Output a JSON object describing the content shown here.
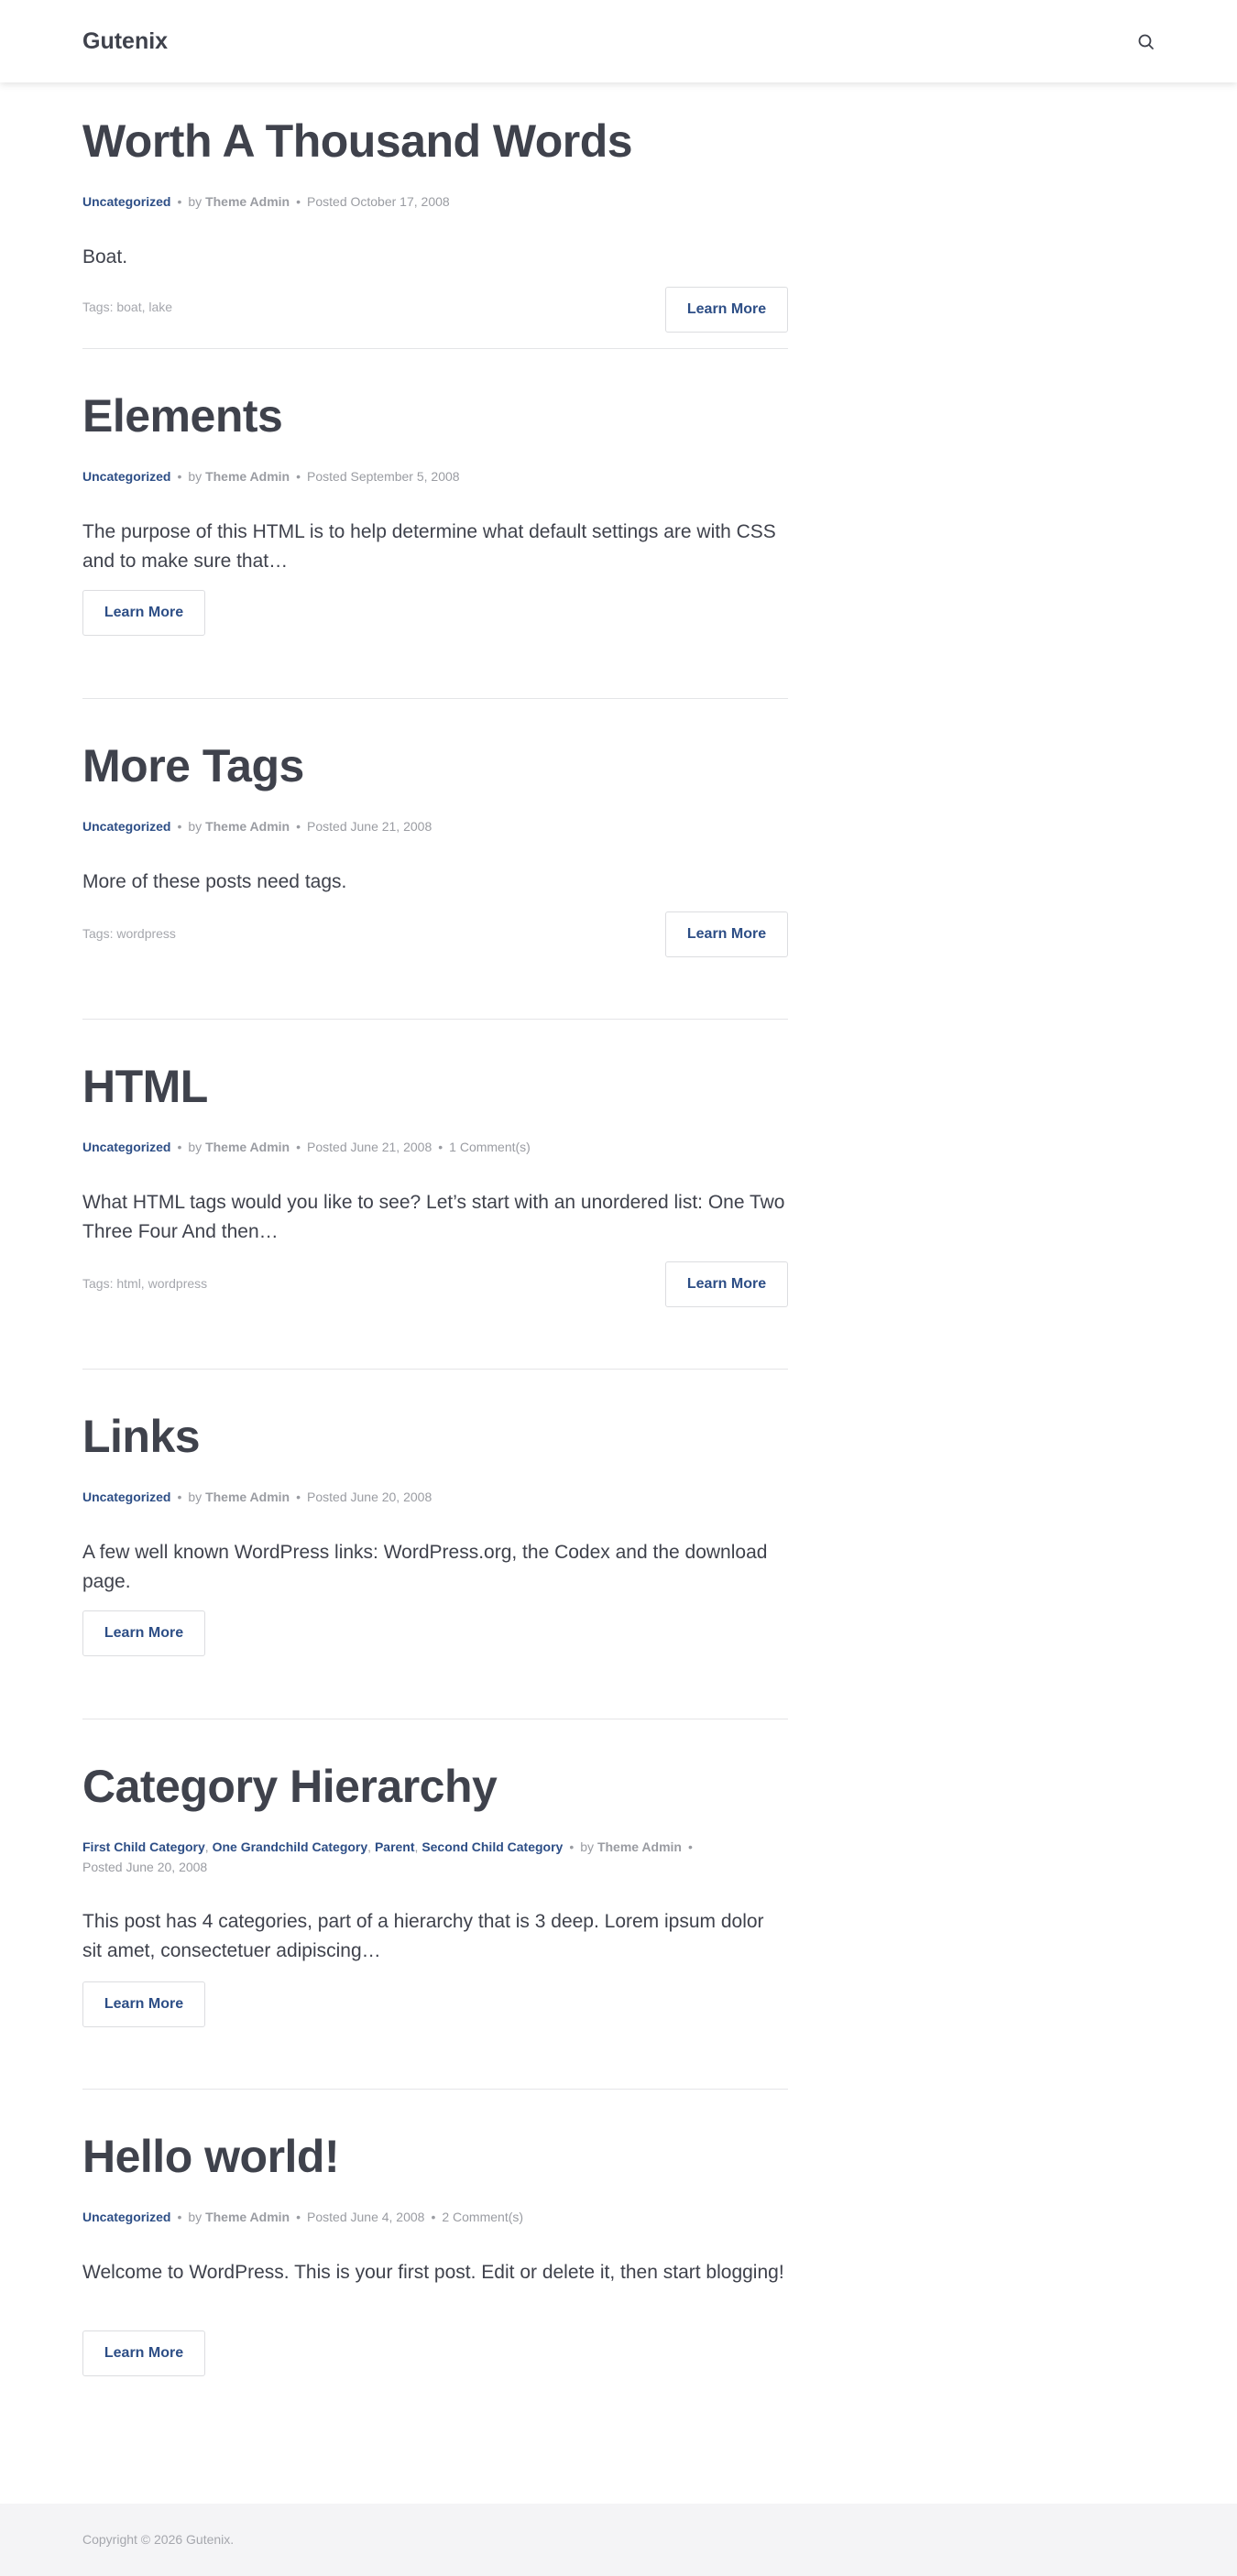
{
  "site": {
    "title": "Gutenix",
    "search_icon": "search-icon"
  },
  "button_label": "Learn More",
  "posts": [
    {
      "title": "Worth A Thousand Words",
      "category": "Uncategorized",
      "author_prefix": "by",
      "author": "Theme Admin",
      "date": "Posted October 17, 2008",
      "excerpt": "Boat.",
      "tags": "Tags: boat, lake"
    },
    {
      "title": "Elements",
      "category": "Uncategorized",
      "author_prefix": "by",
      "author": "Theme Admin",
      "date": "Posted September 5, 2008",
      "excerpt": "The purpose of this HTML is to help determine what default settings are with CSS and to make sure that…"
    },
    {
      "title": "More Tags",
      "category": "Uncategorized",
      "author_prefix": "by",
      "author": "Theme Admin",
      "date": "Posted June 21, 2008",
      "excerpt": "More of these posts need tags.",
      "tags": "Tags: wordpress"
    },
    {
      "title": "HTML",
      "category": "Uncategorized",
      "author_prefix": "by",
      "author": "Theme Admin",
      "date": "Posted June 21, 2008",
      "comments": "1 Comment(s)",
      "excerpt": "What HTML tags would you like to see? Let’s start with an unordered list: One Two Three Four And then…",
      "tags": "Tags: html, wordpress"
    },
    {
      "title": "Links",
      "category": "Uncategorized",
      "author_prefix": "by",
      "author": "Theme Admin",
      "date": "Posted June 20, 2008",
      "excerpt": "A few well known WordPress links: WordPress.org, the Codex and the download page."
    },
    {
      "title": "Category Hierarchy",
      "categories": [
        "First Child Category",
        "One Grandchild Category",
        "Parent",
        "Second Child Category"
      ],
      "author_prefix": "by",
      "author": "Theme Admin",
      "date": "Posted June 20, 2008",
      "excerpt": "This post has 4 categories, part of a hierarchy that is 3 deep. Lorem ipsum dolor sit amet, consectetuer adipiscing…"
    },
    {
      "title": "Hello world!",
      "category": "Uncategorized",
      "author_prefix": "by",
      "author": "Theme Admin",
      "date": "Posted June 4, 2008",
      "comments": "2 Comment(s)",
      "excerpt": "Welcome to WordPress. This is your first post. Edit or delete it, then start blogging!"
    }
  ],
  "separator": "•",
  "comma": ",",
  "footer": {
    "copyright": "Copyright © 2026 Gutenix."
  },
  "colors": {
    "accent": "#2d4e86",
    "text": "#3f424c",
    "muted": "#9a9ca2",
    "footer_bg": "#f4f4f6"
  }
}
